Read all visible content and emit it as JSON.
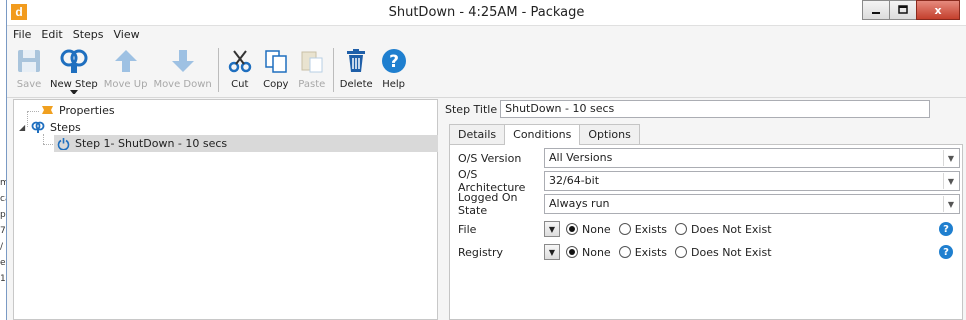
{
  "background": {
    "side_text": [
      "m",
      "ca",
      "p",
      "7",
      "/",
      "e",
      "1"
    ]
  },
  "window": {
    "title": "ShutDown - 4:25AM - Package",
    "app_icon_letter": "d",
    "controls": {
      "minimize": "—",
      "maximize": "□",
      "close": "x"
    }
  },
  "menu": [
    "File",
    "Edit",
    "Steps",
    "View"
  ],
  "toolbar": {
    "save": "Save",
    "new_step": "New Step",
    "move_up": "Move Up",
    "move_down": "Move Down",
    "cut": "Cut",
    "copy": "Copy",
    "paste": "Paste",
    "delete": "Delete",
    "help": "Help"
  },
  "tree": {
    "properties": "Properties",
    "steps": "Steps",
    "expander": "◢",
    "step1": "Step 1- ShutDown - 10 secs"
  },
  "details": {
    "step_title_label": "Step Title",
    "step_title_value": "ShutDown - 10 secs",
    "tabs": [
      "Details",
      "Conditions",
      "Options"
    ],
    "active_tab": "Conditions",
    "os_version_label": "O/S Version",
    "os_version_value": "All Versions",
    "os_arch_label": "O/S Architecture",
    "os_arch_value": "32/64-bit",
    "logged_on_label": "Logged On State",
    "logged_on_value": "Always run",
    "file_label": "File",
    "registry_label": "Registry",
    "radio_none": "None",
    "radio_exists": "Exists",
    "radio_not_exist": "Does Not Exist",
    "selected_file": "None",
    "selected_registry": "None"
  },
  "colors": {
    "accent_blue": "#1f7fcf",
    "app_orange": "#f29b1d",
    "close_red": "#c4402d"
  }
}
